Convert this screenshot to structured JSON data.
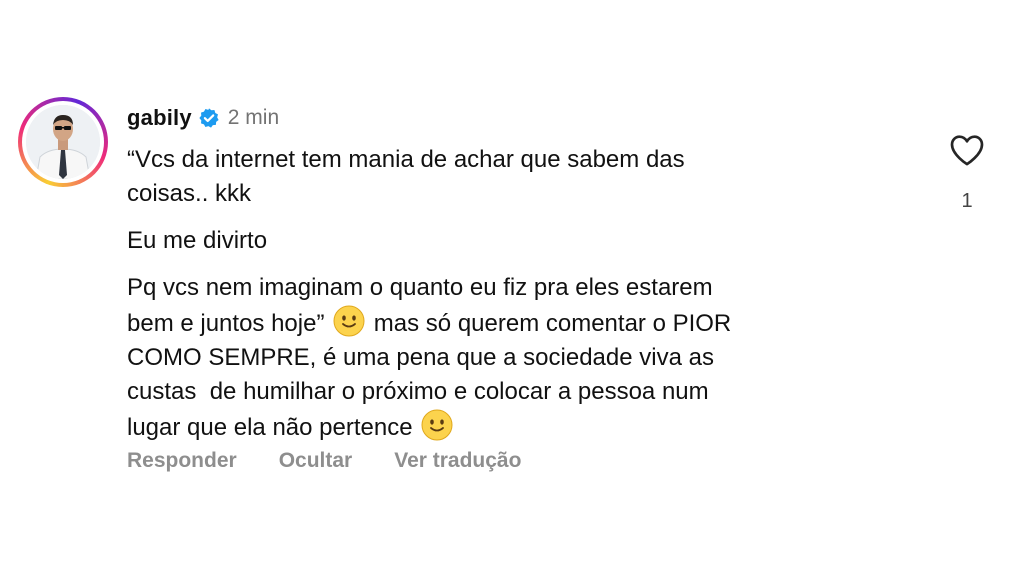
{
  "comment": {
    "username": "gabily",
    "timestamp": "2 min",
    "paragraphs": {
      "p1": "“Vcs da internet tem mania de achar que sabem das\ncoisas.. kkk",
      "p2": "Eu me divirto",
      "p3a": "Pq vcs nem imaginam o quanto eu fiz pra eles estarem\nbem e juntos hoje”",
      "p3b": " mas só querem comentar o PIOR\nCOMO SEMPRE, é uma pena que a sociedade viva as\ncustas  de humilhar o próximo e colocar a pessoa num\nlugar que ela não pertence "
    },
    "actions": {
      "reply": "Responder",
      "hide": "Ocultar",
      "translate": "Ver tradução"
    },
    "likes": "1",
    "icons": {
      "verified": "verified-badge-icon",
      "like": "heart-outline-icon",
      "emoji": "slightly-smiling-face-emoji"
    },
    "colors": {
      "verified": "#1d9bf0",
      "muted": "#8e8e8e"
    }
  }
}
